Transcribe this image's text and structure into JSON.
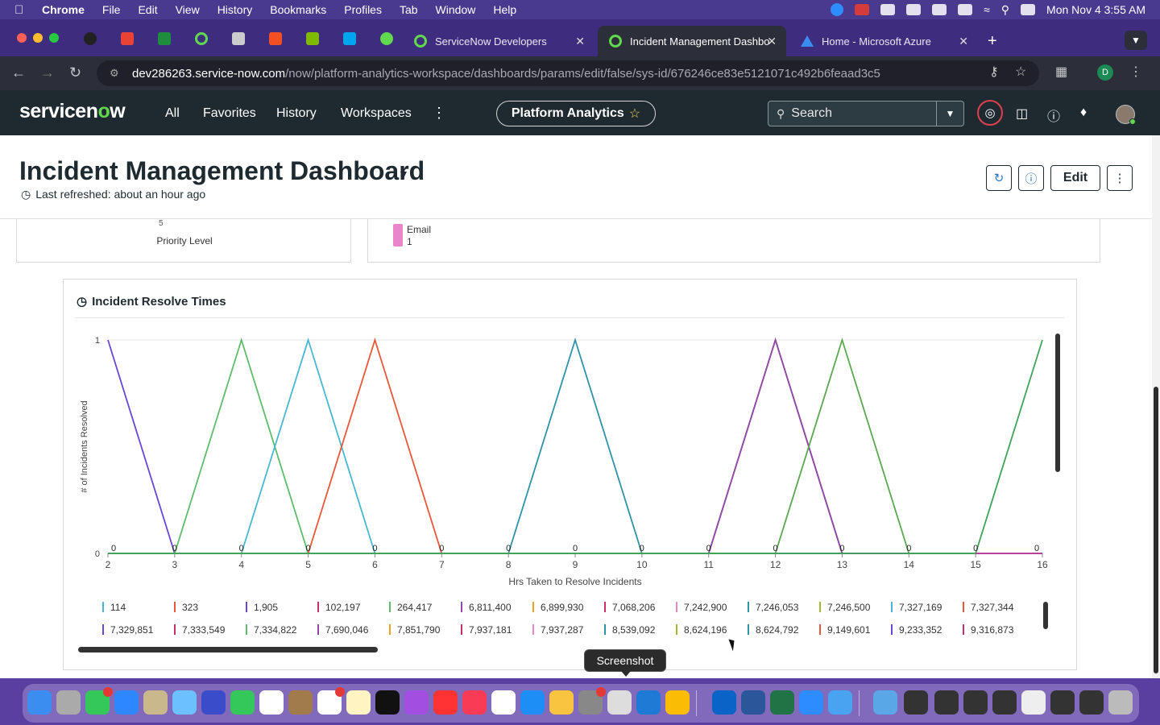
{
  "menubar": {
    "app": "Chrome",
    "items": [
      "File",
      "Edit",
      "View",
      "History",
      "Bookmarks",
      "Profiles",
      "Tab",
      "Window",
      "Help"
    ],
    "clock": "Mon Nov 4  3:55 AM"
  },
  "tabs": {
    "items": [
      {
        "title": "ServiceNow Developers",
        "active": false
      },
      {
        "title": "Incident Management Dashbo",
        "active": true
      },
      {
        "title": "Home - Microsoft Azure",
        "active": false
      }
    ],
    "new_tab": "+"
  },
  "address": {
    "host": "dev286263.service-now.com",
    "path": "/now/platform-analytics-workspace/dashboards/params/edit/false/sys-id/676246ce83e5121071c492b6feaad3c5"
  },
  "profile_initial": "D",
  "sn": {
    "logo_a": "servicen",
    "logo_o": "o",
    "logo_b": "w",
    "nav": [
      "All",
      "Favorites",
      "History",
      "Workspaces"
    ],
    "workspace": "Platform Analytics",
    "search_placeholder": "Search"
  },
  "dashboard": {
    "title": "Incident Management Dashboard",
    "refreshed": "Last refreshed: about an hour ago",
    "edit_label": "Edit"
  },
  "top_cards": {
    "left_tick": "5",
    "left_axis_label": "Priority Level",
    "legend_name": "Email",
    "legend_value": "1",
    "legend_color": "#e886c9"
  },
  "chart_card": {
    "title": "Incident Resolve Times"
  },
  "chart_data": {
    "type": "line",
    "title": "Incident Resolve Times",
    "xlabel": "Hrs Taken to Resolve Incidents",
    "ylabel": "# of Incidents Resolved",
    "x": [
      2,
      3,
      4,
      5,
      6,
      7,
      8,
      9,
      10,
      11,
      12,
      13,
      14,
      15,
      16
    ],
    "xlim": [
      2,
      16
    ],
    "ylim": [
      0,
      1
    ],
    "yticks": [
      0,
      1
    ],
    "point_labels": [
      {
        "x": 2,
        "text": "0"
      },
      {
        "x": 3,
        "text": "0"
      },
      {
        "x": 4,
        "text": "0"
      },
      {
        "x": 5,
        "text": "0"
      },
      {
        "x": 6,
        "text": "0"
      },
      {
        "x": 7,
        "text": "0"
      },
      {
        "x": 8,
        "text": "0"
      },
      {
        "x": 9,
        "text": "0"
      },
      {
        "x": 10,
        "text": "0"
      },
      {
        "x": 11,
        "text": "0"
      },
      {
        "x": 12,
        "text": "0"
      },
      {
        "x": 13,
        "text": "0"
      },
      {
        "x": 14,
        "text": "0"
      },
      {
        "x": 15,
        "text": "0"
      },
      {
        "x": 16,
        "text": "0"
      }
    ],
    "series": [
      {
        "color": "#6a45d6",
        "peak": 2
      },
      {
        "color": "#5dbd6a",
        "peak": 4
      },
      {
        "color": "#49b7d4",
        "peak": 5
      },
      {
        "color": "#e8573a",
        "peak": 6
      },
      {
        "color": "#2f93a8",
        "peak": 9
      },
      {
        "color": "#c6306a",
        "peak": 12
      },
      {
        "color": "#8d4aa8",
        "peak": 12
      },
      {
        "color": "#5aa84f",
        "peak": 13
      },
      {
        "color": "#3fa45a",
        "peak": 16
      },
      {
        "color": "#c03aa0",
        "flat": true
      }
    ],
    "legend": [
      [
        {
          "label": "114",
          "color": "#49b7d4"
        },
        {
          "label": "323",
          "color": "#e8573a"
        },
        {
          "label": "1,905",
          "color": "#6a45d6"
        },
        {
          "label": "102,197",
          "color": "#c6306a"
        },
        {
          "label": "264,417",
          "color": "#5dbd6a"
        },
        {
          "label": "6,811,400",
          "color": "#8d4aa8"
        },
        {
          "label": "6,899,930",
          "color": "#f0a020"
        },
        {
          "label": "7,068,206",
          "color": "#c6306a"
        },
        {
          "label": "7,242,900",
          "color": "#e886c9"
        },
        {
          "label": "7,246,053",
          "color": "#2f93a8"
        },
        {
          "label": "7,246,500",
          "color": "#a4b830"
        },
        {
          "label": "7,327,169",
          "color": "#49b7d4"
        },
        {
          "label": "7,327,344",
          "color": "#e8573a"
        }
      ],
      [
        {
          "label": "7,329,851",
          "color": "#6a45d6"
        },
        {
          "label": "7,333,549",
          "color": "#c6306a"
        },
        {
          "label": "7,334,822",
          "color": "#5dbd6a"
        },
        {
          "label": "7,690,046",
          "color": "#8d4aa8"
        },
        {
          "label": "7,851,790",
          "color": "#f0a020"
        },
        {
          "label": "7,937,181",
          "color": "#c6306a"
        },
        {
          "label": "7,937,287",
          "color": "#e886c9"
        },
        {
          "label": "8,539,092",
          "color": "#2f93a8"
        },
        {
          "label": "8,624,196",
          "color": "#a4b830"
        },
        {
          "label": "8,624,792",
          "color": "#2f93a8"
        },
        {
          "label": "9,149,601",
          "color": "#e8573a"
        },
        {
          "label": "9,233,352",
          "color": "#6a45d6"
        },
        {
          "label": "9,316,873",
          "color": "#c6306a"
        }
      ]
    ]
  },
  "tooltip": "Screenshot"
}
